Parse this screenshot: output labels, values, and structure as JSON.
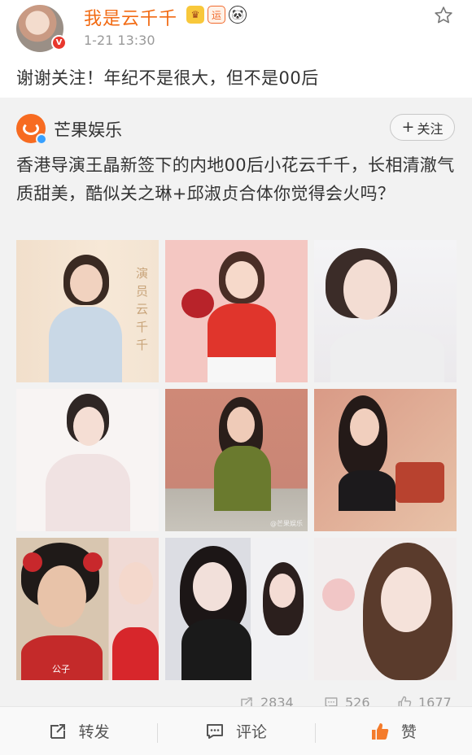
{
  "post": {
    "username": "我是云千千",
    "badges": [
      {
        "icon": "crown-badge-icon",
        "text": "♛"
      },
      {
        "icon": "yun-badge-icon",
        "text": "运"
      },
      {
        "icon": "panda-badge-icon",
        "text": "🐼"
      }
    ],
    "time": "1-21 13:30",
    "text": "谢谢关注！年纪不是很大，但不是00后",
    "username_color": "#f26b14"
  },
  "repost": {
    "source_name": "芒果娱乐",
    "follow_label": "+关注",
    "follow_text": "关注",
    "text": "香港导演王晶新签下的内地00后小花云千千，长相清澈气质甜美，酷似关之琳+邱淑贞合体你觉得会火吗？",
    "photos": [
      {
        "caption": "演员 云千千"
      },
      {
        "caption": ""
      },
      {
        "caption": ""
      },
      {
        "caption": ""
      },
      {
        "caption": "@芒果娱乐"
      },
      {
        "caption": ""
      },
      {
        "caption": "公子"
      },
      {
        "caption": ""
      },
      {
        "caption": ""
      }
    ],
    "stats": {
      "reposts": "2834",
      "comments": "526",
      "likes": "1677"
    }
  },
  "toolbar": {
    "repost_label": "转发",
    "comment_label": "评论",
    "like_label": "赞"
  },
  "colors": {
    "accent_orange": "#f26b14",
    "like_orange": "#f47b2b",
    "card_bg": "#f2f2f2"
  }
}
